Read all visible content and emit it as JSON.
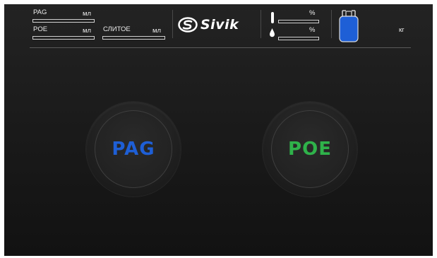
{
  "header": {
    "pag": {
      "label": "PAG",
      "unit": "мл"
    },
    "poe": {
      "label": "POE",
      "unit": "мл"
    },
    "waste": {
      "label": "СЛИТОЕ",
      "unit": "мл"
    },
    "brand": {
      "name": "Sivik"
    },
    "level_top": {
      "unit": "%"
    },
    "level_bottom": {
      "unit": "%"
    },
    "tank": {
      "unit": "кг",
      "color": "#1e5fd6"
    }
  },
  "buttons": {
    "pag": {
      "label": "PAG",
      "color": "#1e5fd6"
    },
    "poe": {
      "label": "POE",
      "color": "#2fb24a"
    }
  },
  "icons": {
    "thermometer": "thermometer-icon",
    "droplet": "droplet-icon",
    "tank": "refrigerant-tank-icon",
    "logo": "sivik-logo-icon"
  }
}
